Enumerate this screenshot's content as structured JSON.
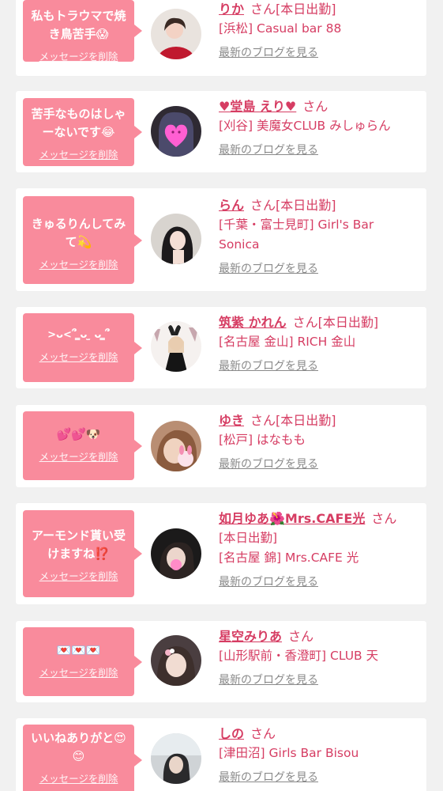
{
  "delete_label": "メッセージを削除",
  "blog_label": "最新のブログを見る",
  "san_label": "さん",
  "working_label": "[本日出勤]",
  "colors": {
    "background": "#f1f1f1",
    "bubble": "#f98b9c",
    "accent": "#d63d63",
    "muted": "#8a8a8a"
  },
  "cards": [
    {
      "message": "私もトラウマで焼き鳥苦手😱",
      "name": "りか",
      "working": true,
      "shop_lines": [
        "[浜松] Casual bar 88"
      ],
      "avatar_icon": "profile-photo-icon"
    },
    {
      "message": "苦手なものはしゃーないです😂",
      "name": "♥堂島 えり♥",
      "working": false,
      "shop_lines": [
        "[刈谷] 美魔女CLUB みしゅらん"
      ],
      "avatar_icon": "profile-photo-icon"
    },
    {
      "message": "きゅるりんしてみて💫",
      "name": "らん",
      "working": true,
      "shop_lines": [
        "[千葉・富士見町] Girl's Bar",
        "Sonica"
      ],
      "avatar_icon": "profile-photo-icon"
    },
    {
      "message": ">ᴗ<՞ ̳ᴗ ̫ ᴗ ̳՞",
      "name": "筑紫 かれん",
      "working": true,
      "shop_lines": [
        "[名古屋 金山] RICH 金山"
      ],
      "avatar_icon": "profile-photo-icon"
    },
    {
      "message": "💕💕🐶",
      "name": "ゆき",
      "working": true,
      "shop_lines": [
        "[松戸] はなもも"
      ],
      "avatar_icon": "profile-photo-icon"
    },
    {
      "message": "アーモンド貰い受けますね⁉️",
      "name": "如月ゆあ🌺Mrs.CAFE光",
      "working": false,
      "line2": "[本日出勤]",
      "shop_lines": [
        "[名古屋 錦] Mrs.CAFE 光"
      ],
      "avatar_icon": "profile-photo-icon"
    },
    {
      "message": "💌💌💌",
      "name": "星空みりあ",
      "working": false,
      "shop_lines": [
        "[山形駅前・香澄町] CLUB 天"
      ],
      "avatar_icon": "profile-photo-icon"
    },
    {
      "message": "いいねありがと😍😊",
      "name": "しの",
      "working": false,
      "shop_lines": [
        "[津田沼] Girls Bar Bisou"
      ],
      "avatar_icon": "profile-photo-icon"
    }
  ]
}
